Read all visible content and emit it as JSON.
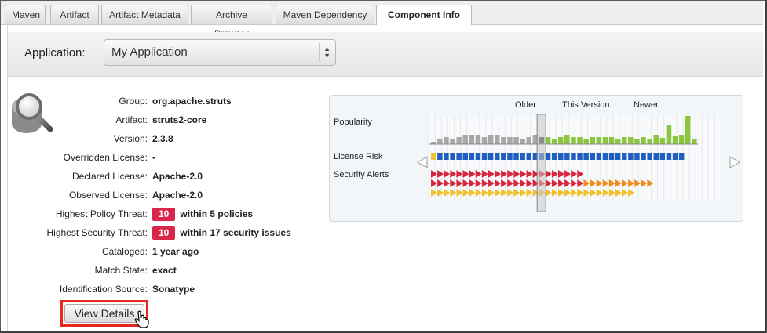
{
  "tabs": [
    {
      "label": "Maven"
    },
    {
      "label": "Artifact"
    },
    {
      "label": "Artifact Metadata"
    },
    {
      "label": "Archive Browser"
    },
    {
      "label": "Maven Dependency"
    },
    {
      "label": "Component Info",
      "active": true
    }
  ],
  "application": {
    "label": "Application:",
    "selected": "My Application"
  },
  "details": [
    {
      "key": "Group:",
      "value": "org.apache.struts"
    },
    {
      "key": "Artifact:",
      "value": "struts2-core"
    },
    {
      "key": "Version:",
      "value": "2.3.8"
    },
    {
      "key": "Overridden License:",
      "value": "-"
    },
    {
      "key": "Declared License:",
      "value": "Apache-2.0"
    },
    {
      "key": "Observed License:",
      "value": "Apache-2.0"
    },
    {
      "key": "Highest Policy Threat:",
      "badge": "10",
      "value": "within 5 policies"
    },
    {
      "key": "Highest Security Threat:",
      "badge": "10",
      "value": "within 17 security issues"
    },
    {
      "key": "Cataloged:",
      "value": "1 year ago"
    },
    {
      "key": "Match State:",
      "value": "exact"
    },
    {
      "key": "Identification Source:",
      "value": "Sonatype"
    }
  ],
  "view_details_label": "View Details",
  "chart": {
    "header_older": "Older",
    "header_this": "This Version",
    "header_newer": "Newer",
    "row_popularity": "Popularity",
    "row_license": "License Risk",
    "row_security": "Security Alerts",
    "colors": {
      "popularity_old": "#a8a8a8",
      "popularity_current": "#444444",
      "popularity_new": "#8cc63f",
      "license_low": "#1f5fbf",
      "license_first": "#f2c12e",
      "critical": "#d7263d",
      "severe": "#f28c1c",
      "moderate": "#f2c12e",
      "selection": "#c8c8c8"
    },
    "popularity_values": [
      1,
      2,
      3,
      2,
      3,
      4,
      4,
      4,
      3,
      4,
      4,
      3,
      3,
      3,
      2,
      3,
      4,
      3,
      3,
      2,
      3,
      4,
      3,
      3,
      2,
      3,
      3,
      3,
      3,
      2,
      3,
      3,
      2,
      3,
      5,
      2,
      3,
      2,
      3,
      5,
      3,
      4
    ],
    "current_index": 17,
    "critical_counts": [
      1,
      1,
      1
    ],
    "security_rows": [
      {
        "color_key": "critical",
        "count": 24
      },
      {
        "color_key": "severe",
        "count": 27
      },
      {
        "color_key": "moderate",
        "count": 25
      }
    ],
    "license_count": 28
  }
}
